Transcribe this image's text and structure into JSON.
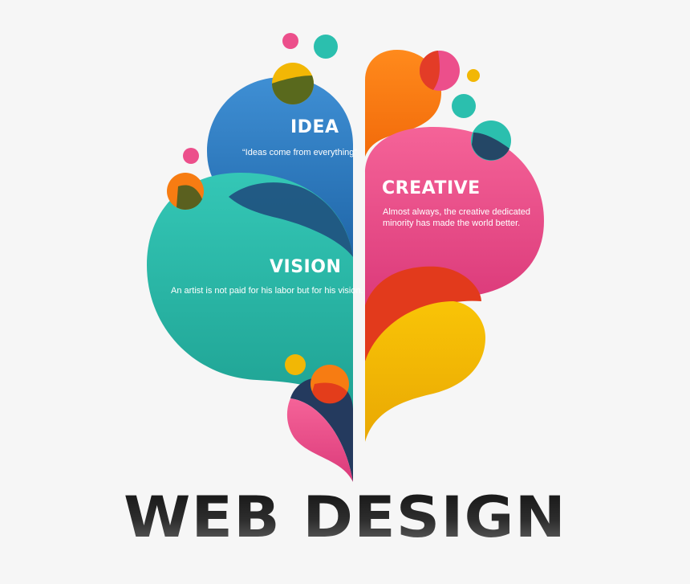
{
  "sections": {
    "idea": {
      "title": "IDEA",
      "text": "“Ideas come from everything”"
    },
    "creative": {
      "title": "CREATIVE",
      "text": "Almost always, the creative dedicated minority has made the world better."
    },
    "vision": {
      "title": "VISION",
      "text": "An artist is not paid for his labor but for his vision."
    }
  },
  "headline": "WEB DESIGN",
  "colors": {
    "blue": "#2f7fc4",
    "teal": "#2bbfae",
    "pink": "#ec4f8b",
    "orange": "#f77c12",
    "yellow": "#f2b705",
    "navy": "#243a5e",
    "background": "#f6f6f6"
  }
}
